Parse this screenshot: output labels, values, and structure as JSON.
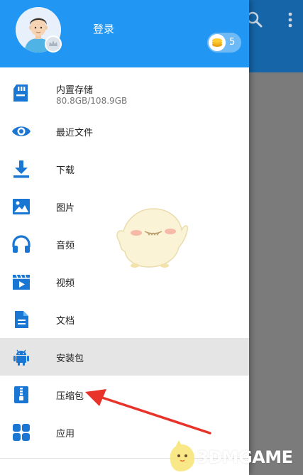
{
  "header": {
    "login_label": "登录",
    "coin_count": "5"
  },
  "menu": {
    "items": [
      {
        "label": "内置存储",
        "sub": "80.8GB/108.9GB",
        "icon": "sd-card-icon"
      },
      {
        "label": "最近文件",
        "icon": "eye-icon"
      },
      {
        "label": "下载",
        "icon": "download-icon"
      },
      {
        "label": "图片",
        "icon": "image-icon"
      },
      {
        "label": "音频",
        "icon": "headphones-icon"
      },
      {
        "label": "视频",
        "icon": "video-icon"
      },
      {
        "label": "文档",
        "icon": "document-icon"
      },
      {
        "label": "安装包",
        "icon": "android-icon",
        "selected": true
      },
      {
        "label": "压缩包",
        "icon": "zip-icon"
      },
      {
        "label": "应用",
        "icon": "apps-grid-icon"
      }
    ]
  },
  "watermark": {
    "text": "3DMGAME"
  },
  "colors": {
    "header_blue": "#2196f3",
    "icon_blue": "#1976d2",
    "appbar_dark": "#1565a8",
    "selected_row": "#e5e5e5",
    "annotation_red": "#e8332b"
  }
}
